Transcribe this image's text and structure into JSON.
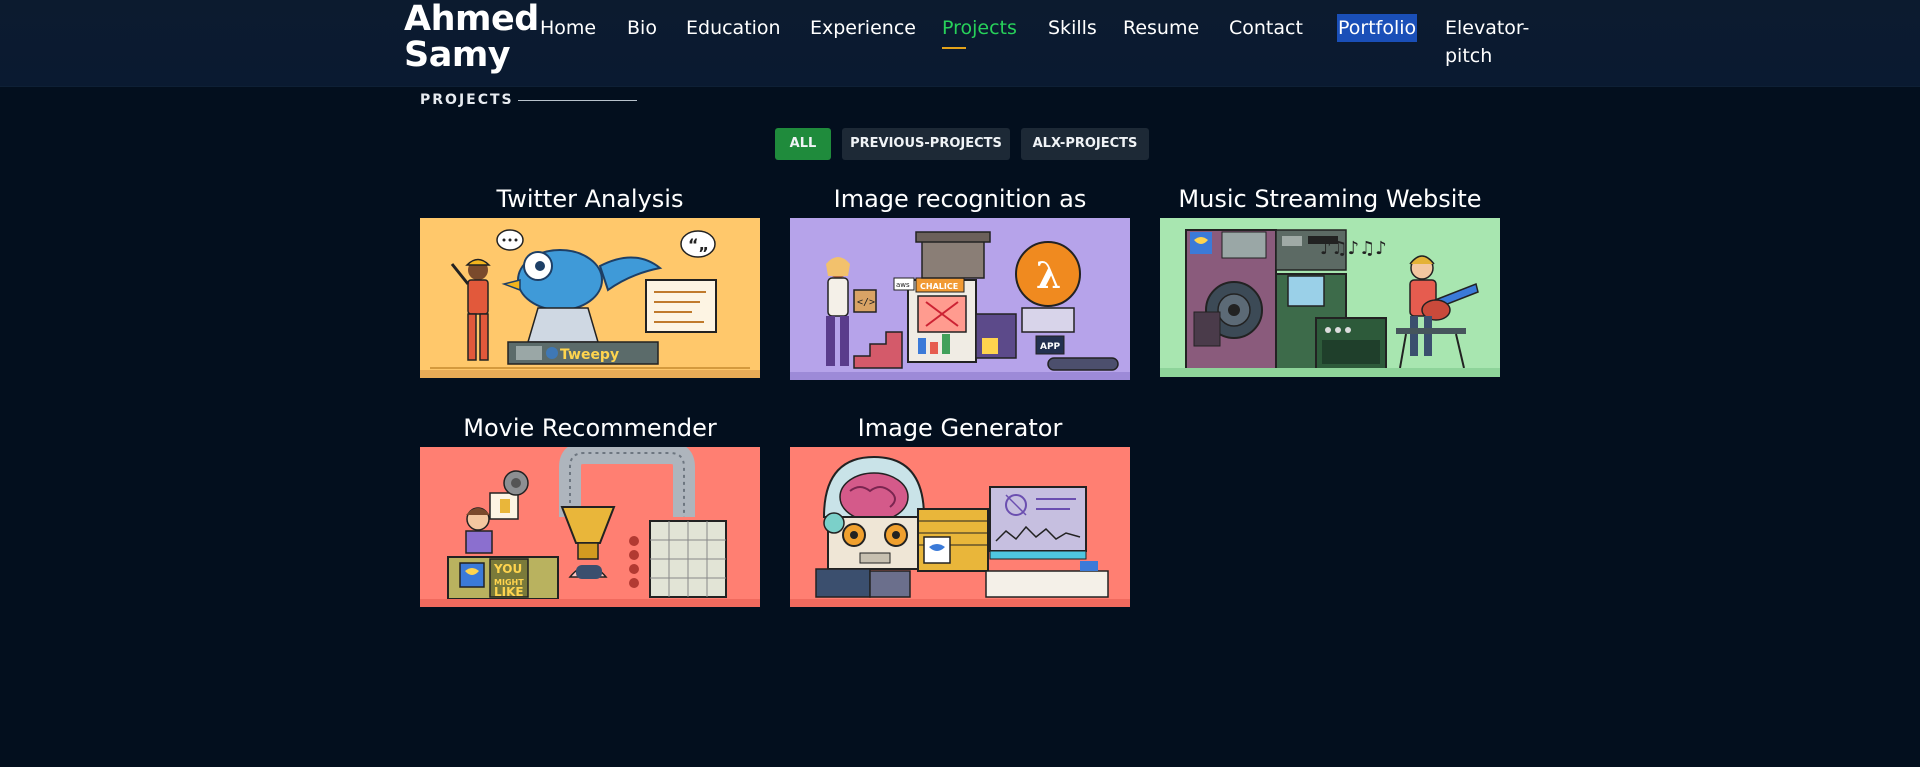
{
  "header": {
    "brand": "Ahmed Samy",
    "nav": [
      {
        "label": "Home"
      },
      {
        "label": "Bio"
      },
      {
        "label": "Education"
      },
      {
        "label": "Experience"
      },
      {
        "label": "Projects"
      },
      {
        "label": "Skills"
      },
      {
        "label": "Resume"
      },
      {
        "label": "Contact"
      },
      {
        "label": "Portfolio"
      },
      {
        "label": "Elevator-pitch"
      }
    ],
    "active_item": "Projects",
    "highlighted_item": "Portfolio"
  },
  "section": {
    "title": "PROJECTS"
  },
  "filters": [
    {
      "label": "ALL",
      "active": true
    },
    {
      "label": "PREVIOUS-PROJECTS",
      "active": false
    },
    {
      "label": "ALX-PROJECTS",
      "active": false
    }
  ],
  "projects": [
    {
      "title": "Twitter Analysis",
      "thumb_bg": "#ffc86b",
      "thumb_text": "Tweepy",
      "thumb_icon": "bird-icon"
    },
    {
      "title": "Image recognition as Service",
      "thumb_bg": "#b6a3ea",
      "thumb_text": "CHALICE",
      "thumb_text2": "aws",
      "thumb_text3": "APP",
      "thumb_icon": "lambda-icon"
    },
    {
      "title": "Music Streaming Website",
      "thumb_bg": "#a8e6b0",
      "thumb_icon": "speaker-icon"
    },
    {
      "title": "Movie Recommender",
      "thumb_bg": "#ff7f72",
      "thumb_text": "YOU MIGHT LIKE",
      "thumb_icon": "funnel-icon"
    },
    {
      "title": "Image Generator",
      "thumb_bg": "#ff7f72",
      "thumb_icon": "robot-brain-icon"
    }
  ],
  "colors": {
    "page_bg": "#030f1e",
    "header_bg": "#0c1b2f",
    "active_nav": "#27d15a",
    "nav_underline": "#e3a21a",
    "highlight_bg": "#1a4fb8",
    "filter_active": "#1f8b3c",
    "filter_inactive": "#1d2936"
  }
}
